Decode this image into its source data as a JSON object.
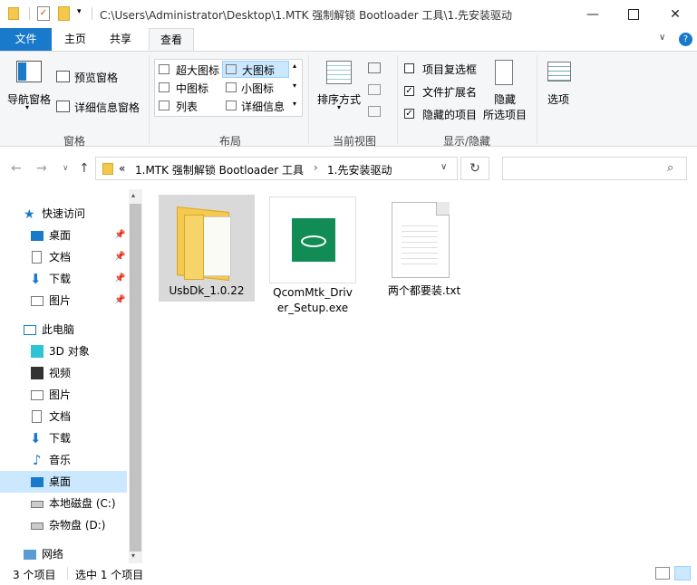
{
  "window": {
    "title": "C:\\Users\\Administrator\\Desktop\\1.MTK 强制解锁 Bootloader 工具\\1.先安装驱动",
    "minimize_icon": "minimize-icon",
    "maximize_icon": "maximize-icon",
    "close_icon": "close-icon"
  },
  "ribbon_tabs": {
    "file": "文件",
    "home": "主页",
    "share": "共享",
    "view": "查看"
  },
  "ribbon": {
    "panes": {
      "nav_pane": "导航窗格",
      "preview_pane": "预览窗格",
      "details_pane": "详细信息窗格",
      "group": "窗格"
    },
    "layout": {
      "extra_large": "超大图标",
      "large": "大图标",
      "medium": "中图标",
      "small": "小图标",
      "list": "列表",
      "details": "详细信息",
      "group": "布局"
    },
    "current_view": {
      "sort_by": "排序方式",
      "group": "当前视图"
    },
    "show_hide": {
      "item_checkboxes": "项目复选框",
      "file_extensions": "文件扩展名",
      "hidden_items": "隐藏的项目",
      "hide_selected_1": "隐藏",
      "hide_selected_2": "所选项目",
      "group": "显示/隐藏",
      "item_checkboxes_checked": false,
      "file_extensions_checked": true,
      "hidden_items_checked": true
    },
    "options": "选项"
  },
  "address": {
    "prefix": "«",
    "crumbs": [
      "1.MTK 强制解锁 Bootloader 工具",
      "1.先安装驱动"
    ],
    "separator": "›",
    "search_placeholder": ""
  },
  "nav_pane": {
    "quick_access": "快速访问",
    "quick_items": [
      "桌面",
      "文档",
      "下载",
      "图片"
    ],
    "this_pc": "此电脑",
    "pc_items": [
      "3D 对象",
      "视频",
      "图片",
      "文档",
      "下载",
      "音乐",
      "桌面",
      "本地磁盘 (C:)",
      "杂物盘 (D:)"
    ],
    "network": "网络"
  },
  "files": [
    {
      "name": "UsbDk_1.0.22",
      "type": "folder",
      "selected": true
    },
    {
      "name": "QcomMtk_Driv er_Setup.exe",
      "line1": "QcomMtk_Driv",
      "line2": "er_Setup.exe",
      "type": "exe",
      "selected": false
    },
    {
      "name": "两个都要装.txt",
      "type": "txt",
      "selected": false
    }
  ],
  "status": {
    "item_count": "3 个项目",
    "selected": "选中 1 个项目"
  },
  "colors": {
    "accent": "#1979ca",
    "selection": "#cce8ff",
    "exe_green": "#108c54"
  }
}
